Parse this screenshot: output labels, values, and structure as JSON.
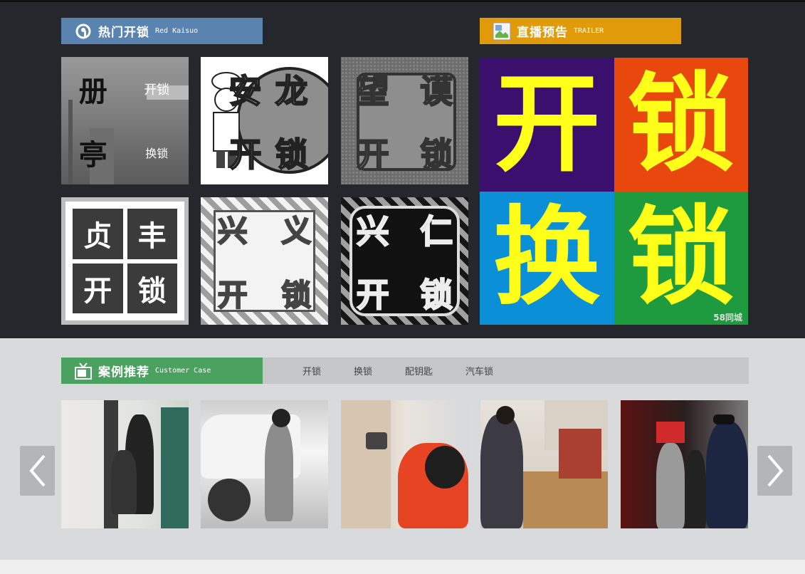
{
  "hot_section": {
    "title": "热门开锁",
    "subtitle": "Red Kaisuo",
    "icon": "swirl-icon",
    "color": "#5a83b0",
    "tiles": [
      {
        "chars": [
          "册",
          "开锁",
          "亭",
          "换锁"
        ]
      },
      {
        "chars": [
          "安",
          "龙",
          "开",
          "锁"
        ]
      },
      {
        "chars": [
          "望",
          "谟",
          "开",
          "锁"
        ]
      },
      {
        "chars": [
          "贞",
          "丰",
          "开",
          "锁"
        ]
      },
      {
        "chars": [
          "兴",
          "义",
          "开",
          "锁"
        ]
      },
      {
        "chars": [
          "兴",
          "仁",
          "开",
          "锁"
        ]
      }
    ]
  },
  "live_section": {
    "title": "直播预告",
    "subtitle": "TRAILER",
    "icon": "broken-image-icon",
    "color": "#e19a0a",
    "poster": {
      "chars": [
        "开",
        "锁",
        "换",
        "锁"
      ],
      "quadrant_colors": [
        "#3a0f6e",
        "#e8470e",
        "#0b8fd6",
        "#1f9b3f"
      ],
      "watermark": "58同城"
    }
  },
  "case_section": {
    "title": "案例推荐",
    "subtitle": "Customer Case",
    "icon": "tv-icon",
    "color": "#4aa160",
    "tabs": [
      "开锁",
      "换锁",
      "配钥匙",
      "汽车锁"
    ]
  },
  "carousel": {
    "prev_icon": "chevron-left-icon",
    "next_icon": "chevron-right-icon"
  }
}
